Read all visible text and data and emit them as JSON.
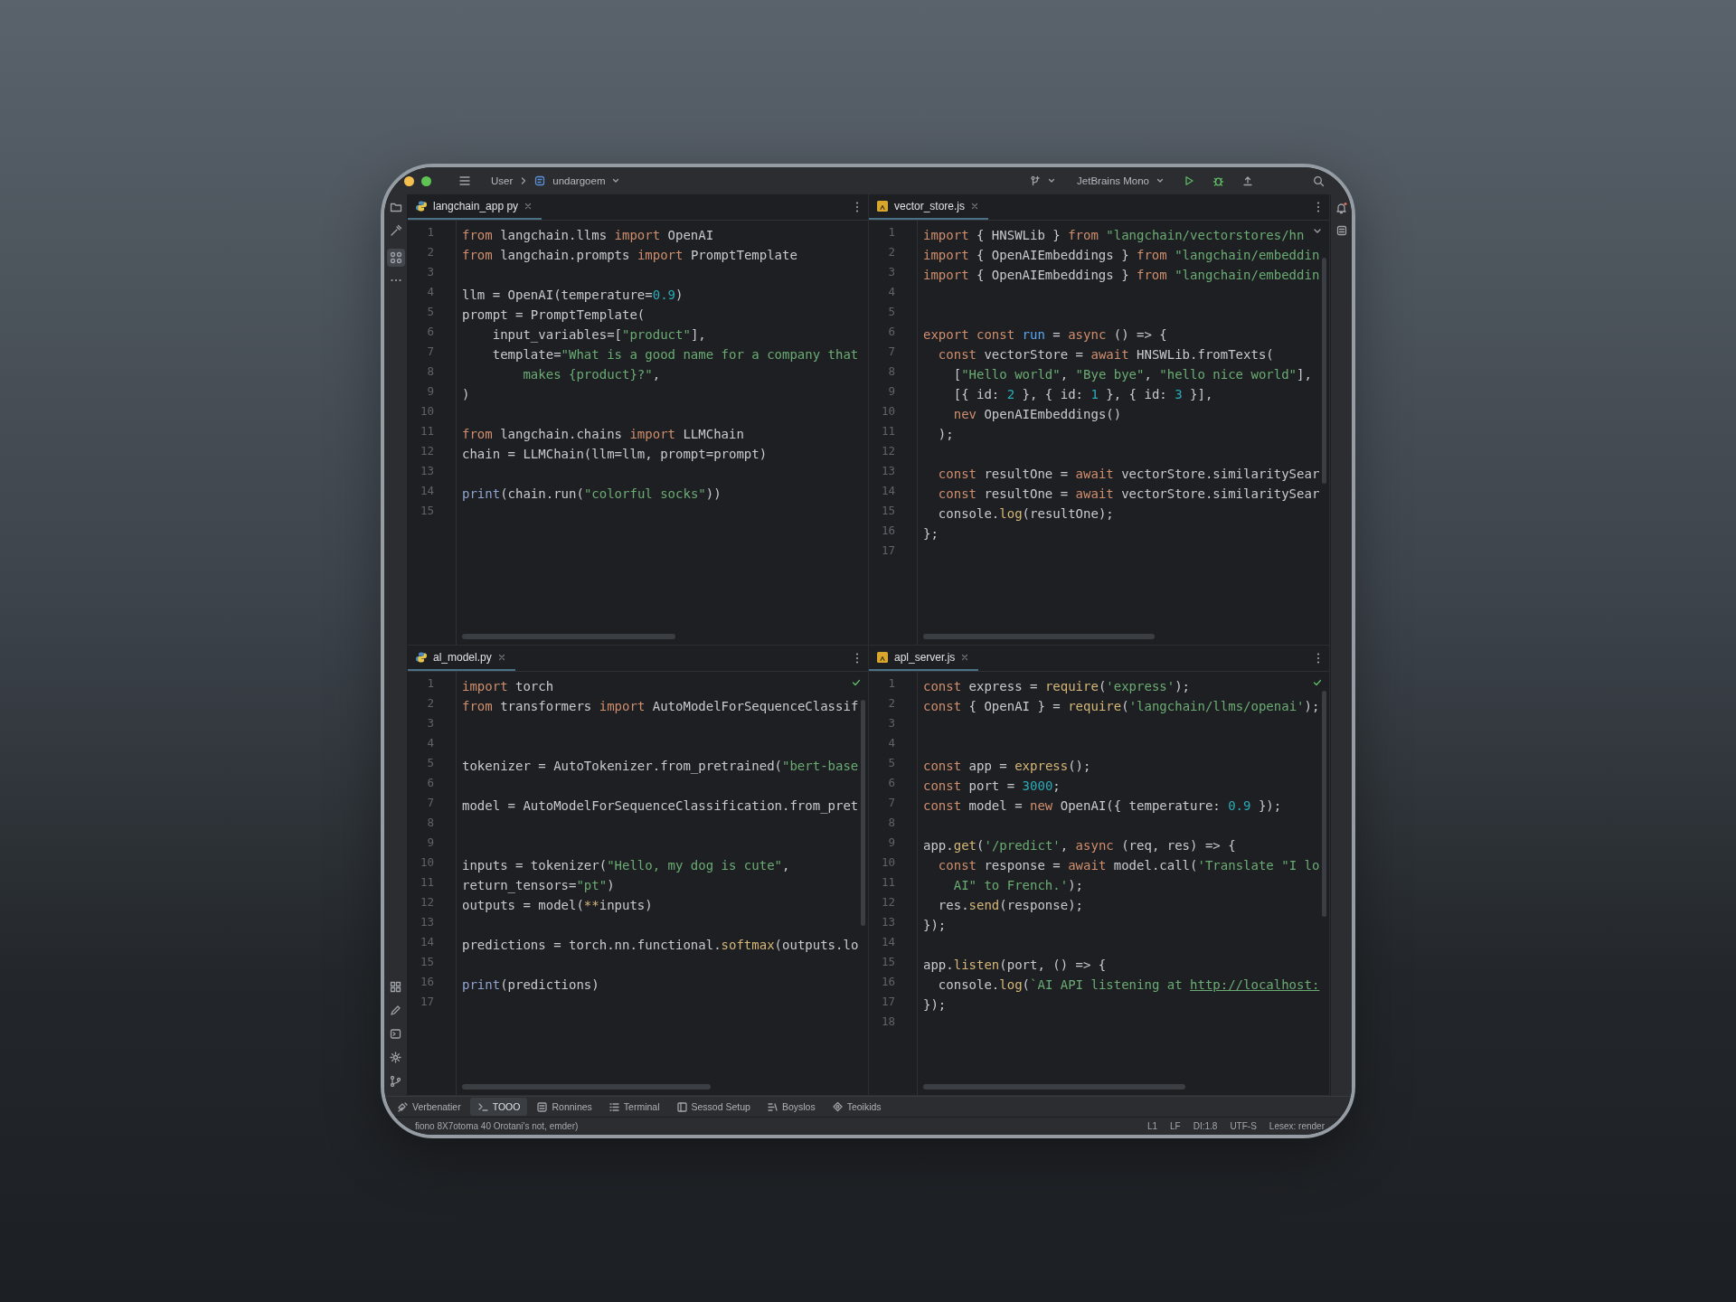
{
  "title_bar": {
    "path_root": "User",
    "project": "undargoem",
    "font_selector": "JetBrains Mono"
  },
  "editors": [
    {
      "tab": {
        "label": "langchain_app py",
        "kind": "python",
        "selected": true
      },
      "lines": [
        {
          "number": "1",
          "code": [
            {
              "kind": "keyword",
              "text": "from"
            },
            " langchain.llms ",
            {
              "kind": "keyword",
              "text": "import"
            },
            " OpenAI"
          ]
        },
        {
          "number": "2",
          "code": [
            {
              "kind": "keyword",
              "text": "from"
            },
            " langchain.prompts ",
            {
              "kind": "keyword",
              "text": "import"
            },
            " PromptTemplate"
          ]
        },
        {
          "number": "3"
        },
        {
          "number": "4",
          "code": [
            "llm = OpenAI(temperature=",
            {
              "kind": "number",
              "text": "0.9"
            },
            ")"
          ]
        },
        {
          "number": "5",
          "code": [
            "prompt = PromptTemplate("
          ]
        },
        {
          "number": "6",
          "code": [
            "    input_variables=[",
            {
              "kind": "string",
              "text": "\"product\""
            },
            "],"
          ]
        },
        {
          "number": "7",
          "code": [
            "    template=",
            {
              "kind": "string",
              "text": "\"What is a good name for a company that"
            }
          ]
        },
        {
          "number": "8",
          "code": [
            {
              "kind": "string",
              "text": "        makes {product}?\""
            },
            ","
          ]
        },
        {
          "number": "9",
          "code": [
            ")"
          ]
        },
        {
          "number": "10"
        },
        {
          "number": "11",
          "code": [
            {
              "kind": "keyword",
              "text": "from"
            },
            " langchain.chains ",
            {
              "kind": "keyword",
              "text": "import"
            },
            " LLMChain"
          ]
        },
        {
          "number": "12",
          "code": [
            "chain = LLMChain(llm=llm, prompt=prompt)"
          ]
        },
        {
          "number": "13"
        },
        {
          "number": "14",
          "code": [
            {
              "kind": "builtin",
              "text": "print"
            },
            "(chain.run(",
            {
              "kind": "string",
              "text": "\"colorful socks\""
            },
            "))"
          ]
        },
        {
          "number": "15"
        }
      ]
    },
    {
      "tab": {
        "label": "vector_store.js",
        "kind": "javascript",
        "selected": true
      },
      "lines": [
        {
          "number": "1",
          "code": [
            {
              "kind": "keyword",
              "text": "import"
            },
            " { HNSWLib } ",
            {
              "kind": "keyword",
              "text": "from"
            },
            {
              "kind": "string",
              "text": " \"langchain/vectorstores/hn"
            }
          ]
        },
        {
          "number": "2",
          "code": [
            {
              "kind": "keyword",
              "text": "import"
            },
            " { OpenAIEmbeddings } ",
            {
              "kind": "keyword",
              "text": "from"
            },
            {
              "kind": "string",
              "text": " \"langchain/embeddin"
            }
          ]
        },
        {
          "number": "3",
          "code": [
            {
              "kind": "keyword",
              "text": "import"
            },
            " { OpenAIEmbeddings } ",
            {
              "kind": "keyword",
              "text": "from"
            },
            {
              "kind": "string",
              "text": " \"langchain/embeddin"
            }
          ]
        },
        {
          "number": "4"
        },
        {
          "number": "5"
        },
        {
          "number": "6",
          "code": [
            {
              "kind": "keyword",
              "text": "export const "
            },
            {
              "kind": "function",
              "text": "run"
            },
            " = ",
            {
              "kind": "keyword",
              "text": "async"
            },
            " () => {"
          ]
        },
        {
          "number": "7",
          "code": [
            {
              "kind": "keyword",
              "text": "  const"
            },
            " vectorStore = ",
            {
              "kind": "keyword",
              "text": "await"
            },
            " HNSWLib.fromTexts("
          ]
        },
        {
          "number": "8",
          "code": [
            "    [",
            {
              "kind": "string",
              "text": "\"Hello world\""
            },
            ", ",
            {
              "kind": "string",
              "text": "\"Bye bye\""
            },
            ", ",
            {
              "kind": "string",
              "text": "\"hello nice world\""
            },
            "],"
          ]
        },
        {
          "number": "9",
          "code": [
            "    [{ id: ",
            {
              "kind": "number",
              "text": "2"
            },
            " }, { id: ",
            {
              "kind": "number",
              "text": "1"
            },
            " }, { id: ",
            {
              "kind": "number",
              "text": "3"
            },
            " }],"
          ]
        },
        {
          "number": "10",
          "code": [
            {
              "kind": "keyword",
              "text": "    nev"
            },
            " OpenAIEmbeddings()"
          ]
        },
        {
          "number": "11",
          "code": [
            "  );"
          ]
        },
        {
          "number": "12"
        },
        {
          "number": "13",
          "code": [
            {
              "kind": "keyword",
              "text": "  const"
            },
            " resultOne = ",
            {
              "kind": "keyword",
              "text": "await"
            },
            " vectorStore.similaritySear"
          ]
        },
        {
          "number": "14",
          "code": [
            {
              "kind": "keyword",
              "text": "  const"
            },
            " resultOne = ",
            {
              "kind": "keyword",
              "text": "await"
            },
            " vectorStore.similaritySear"
          ]
        },
        {
          "number": "15",
          "code": [
            "  console.",
            {
              "kind": "method",
              "text": "log"
            },
            "(resultOne);"
          ]
        },
        {
          "number": "16",
          "code": [
            "};"
          ]
        },
        {
          "number": "17"
        }
      ]
    },
    {
      "tab": {
        "label": "al_model.py",
        "kind": "python",
        "selected": true
      },
      "lines": [
        {
          "number": "1",
          "code": [
            {
              "kind": "keyword",
              "text": "import"
            },
            " torch"
          ]
        },
        {
          "number": "2",
          "code": [
            {
              "kind": "keyword",
              "text": "from"
            },
            " transformers ",
            {
              "kind": "keyword",
              "text": "import"
            },
            " AutoModelForSequenceClassif"
          ]
        },
        {
          "number": "3"
        },
        {
          "number": "4"
        },
        {
          "number": "5",
          "code": [
            "tokenizer = AutoTokenizer.from_pretrained(",
            {
              "kind": "string",
              "text": "\"bert-base"
            }
          ]
        },
        {
          "number": "6"
        },
        {
          "number": "7",
          "code": [
            "model = AutoModelForSequenceClassification.from_pret"
          ]
        },
        {
          "number": "8"
        },
        {
          "number": "9"
        },
        {
          "number": "10",
          "code": [
            "inputs = tokenizer(",
            {
              "kind": "string",
              "text": "\"Hello, my dog is cute\""
            },
            ","
          ]
        },
        {
          "number": "11",
          "code": [
            "return_tensors=",
            {
              "kind": "string",
              "text": "\"pt\""
            },
            ")"
          ]
        },
        {
          "number": "12",
          "code": [
            "outputs = model(",
            {
              "kind": "method",
              "text": "**"
            },
            "inputs)"
          ]
        },
        {
          "number": "13"
        },
        {
          "number": "14",
          "code": [
            "predictions = torch.nn.functional.",
            {
              "kind": "method",
              "text": "softmax"
            },
            "(outputs.lo"
          ]
        },
        {
          "number": "15"
        },
        {
          "number": "16",
          "code": [
            {
              "kind": "builtin",
              "text": "print"
            },
            "(predictions)"
          ]
        },
        {
          "number": "17"
        }
      ]
    },
    {
      "tab": {
        "label": "apl_server.js",
        "kind": "javascript",
        "selected": true
      },
      "lines": [
        {
          "number": "1",
          "code": [
            {
              "kind": "keyword",
              "text": "const"
            },
            " express = ",
            {
              "kind": "method",
              "text": "require"
            },
            "(",
            {
              "kind": "string",
              "text": "'express'"
            },
            ");"
          ]
        },
        {
          "number": "2",
          "code": [
            {
              "kind": "keyword",
              "text": "const"
            },
            " { OpenAI } = ",
            {
              "kind": "method",
              "text": "require"
            },
            "(",
            {
              "kind": "string",
              "text": "'langchain/llms/openai'"
            },
            ");"
          ]
        },
        {
          "number": "3"
        },
        {
          "number": "4"
        },
        {
          "number": "5",
          "code": [
            {
              "kind": "keyword",
              "text": "const"
            },
            " app = ",
            {
              "kind": "method",
              "text": "express"
            },
            "();"
          ]
        },
        {
          "number": "6",
          "code": [
            {
              "kind": "keyword",
              "text": "const"
            },
            " port = ",
            {
              "kind": "number",
              "text": "3000"
            },
            ";"
          ]
        },
        {
          "number": "7",
          "code": [
            {
              "kind": "keyword",
              "text": "const"
            },
            " model = ",
            {
              "kind": "keyword",
              "text": "new"
            },
            " OpenAI({ temperature: ",
            {
              "kind": "number",
              "text": "0.9"
            },
            " });"
          ]
        },
        {
          "number": "8"
        },
        {
          "number": "9",
          "code": [
            "app.",
            {
              "kind": "method",
              "text": "get"
            },
            "(",
            {
              "kind": "string",
              "text": "'/predict'"
            },
            ", ",
            {
              "kind": "keyword",
              "text": "async"
            },
            " (req, res) => {"
          ]
        },
        {
          "number": "10",
          "code": [
            {
              "kind": "keyword",
              "text": "  const"
            },
            " response = ",
            {
              "kind": "keyword",
              "text": "await"
            },
            " model.call(",
            {
              "kind": "string",
              "text": "'Translate \"I lo"
            }
          ]
        },
        {
          "number": "11",
          "code": [
            {
              "kind": "string",
              "text": "    AI\" to French.'"
            },
            ");"
          ]
        },
        {
          "number": "12",
          "code": [
            "  res.",
            {
              "kind": "method",
              "text": "send"
            },
            "(response);"
          ]
        },
        {
          "number": "13",
          "code": [
            "});"
          ]
        },
        {
          "number": "14"
        },
        {
          "number": "15",
          "code": [
            "app.",
            {
              "kind": "method",
              "text": "listen"
            },
            "(port, () => {"
          ]
        },
        {
          "number": "16",
          "code": [
            "  console.",
            {
              "kind": "method",
              "text": "log"
            },
            "(",
            {
              "kind": "string",
              "text": "`AI API listening at "
            },
            {
              "kind": "link",
              "text": "http://localhost:"
            }
          ]
        },
        {
          "number": "17",
          "code": [
            "});"
          ]
        },
        {
          "number": "18"
        }
      ]
    }
  ],
  "tool_windows": [
    {
      "label": "Verbenatier",
      "selected": false
    },
    {
      "label": "TOOO",
      "selected": true
    },
    {
      "label": "Ronnines",
      "selected": false
    },
    {
      "label": "Terminal",
      "selected": false
    },
    {
      "label": "Sessod Setup",
      "selected": false
    },
    {
      "label": "Boyslos",
      "selected": false
    },
    {
      "label": "Teoikids",
      "selected": false
    }
  ],
  "status_bar": {
    "message": "fiono 8X7otoma 40 Orotani's not, emder)",
    "items": [
      "L1",
      "LF",
      "DI:1.8",
      "UTF-S",
      "Lesex: render"
    ]
  }
}
